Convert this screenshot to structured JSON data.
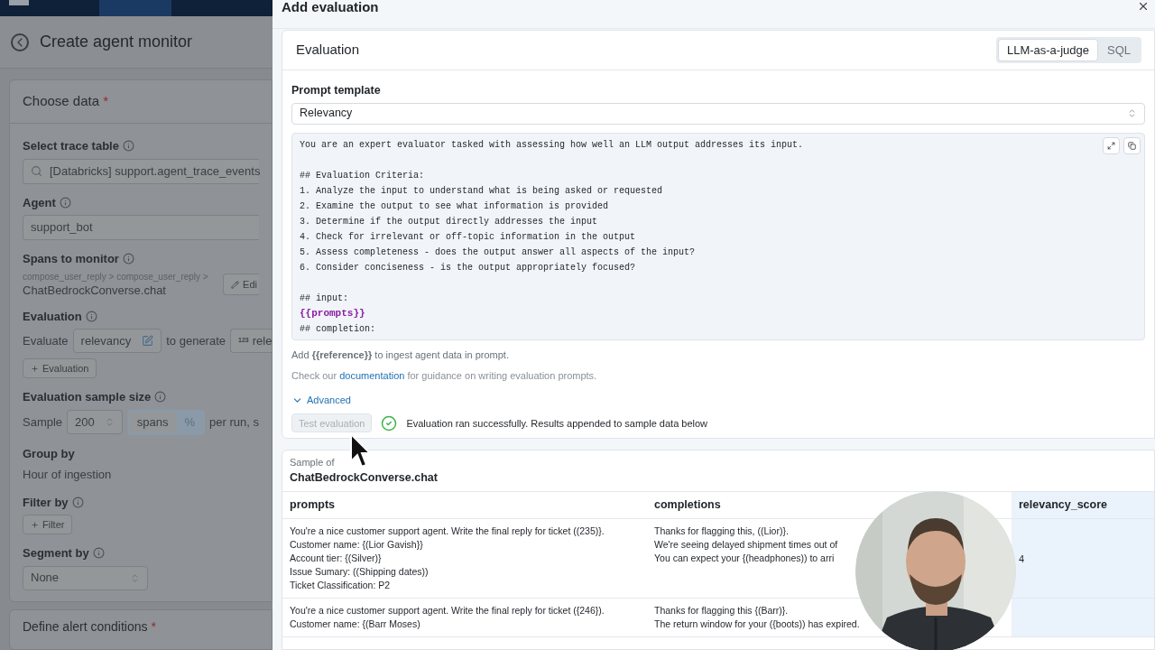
{
  "page": {
    "title": "Create agent monitor"
  },
  "choose_data": {
    "title": "Choose data",
    "required_mark": "*",
    "trace_table": {
      "label": "Select trace table",
      "value": "[Databricks] support.agent_trace_events"
    },
    "agent": {
      "label": "Agent",
      "value": "support_bot"
    },
    "spans": {
      "label": "Spans to monitor",
      "path": "compose_user_reply > compose_user_reply >",
      "span": "ChatBedrockConverse.chat",
      "edit_button": "Edi"
    },
    "evaluation": {
      "label": "Evaluation",
      "prefix": "Evaluate",
      "evaluator": "relevancy",
      "middle": "to generate",
      "metric_type": "123",
      "metric": "rele",
      "add_button": "Evaluation"
    },
    "sample_size": {
      "label": "Evaluation sample size",
      "prefix": "Sample",
      "value": "200",
      "units": [
        {
          "label": "spans",
          "selected": true
        },
        {
          "label": "%",
          "selected": false
        }
      ],
      "suffix": "per run, s"
    },
    "group_by": {
      "label": "Group by",
      "value": "Hour of ingestion"
    },
    "filter_by": {
      "label": "Filter by",
      "add_button": "Filter"
    },
    "segment_by": {
      "label": "Segment by",
      "value": "None"
    }
  },
  "alert_conditions": {
    "title": "Define alert conditions",
    "required_mark": "*"
  },
  "drawer": {
    "title": "Add evaluation",
    "evaluation_card": {
      "title": "Evaluation",
      "modes": [
        {
          "label": "LLM-as-a-judge",
          "selected": true
        },
        {
          "label": "SQL",
          "selected": false
        }
      ],
      "prompt_template": {
        "label": "Prompt template",
        "value": "Relevancy"
      },
      "prompt_lines": [
        {
          "kind": "text",
          "text": "You are an expert evaluator tasked with assessing how well an LLM output addresses its input."
        },
        {
          "kind": "blank"
        },
        {
          "kind": "text",
          "text": "## Evaluation Criteria:"
        },
        {
          "kind": "text",
          "text": "1. Analyze the input to understand what is being asked or requested"
        },
        {
          "kind": "text",
          "text": "2. Examine the output to see what information is provided"
        },
        {
          "kind": "text",
          "text": "3. Determine if the output directly addresses the input"
        },
        {
          "kind": "text",
          "text": "4. Check for irrelevant or off-topic information in the output"
        },
        {
          "kind": "text",
          "text": "5. Assess completeness - does the output answer all aspects of the input?"
        },
        {
          "kind": "text",
          "text": "6. Consider conciseness - is the output appropriately focused?"
        },
        {
          "kind": "blank"
        },
        {
          "kind": "text",
          "text": "## input:"
        },
        {
          "kind": "variable",
          "text": "{{prompts}}"
        },
        {
          "kind": "text",
          "text": "## completion:"
        }
      ],
      "hint": "Add **{{reference}}** to ingest agent data in prompt.",
      "docs": {
        "before": "Check our",
        "link": "documentation",
        "after": "for guidance on writing evaluation prompts."
      },
      "advanced": {
        "label": "Advanced",
        "expanded": false
      },
      "test_button": {
        "label": "Test evaluation",
        "disabled": true
      },
      "status": {
        "kind": "success",
        "text": "Evaluation ran successfully. Results appended to sample data below"
      }
    },
    "sample_card": {
      "caption": "Sample of",
      "span": "ChatBedrockConverse.chat",
      "columns": [
        {
          "label": "prompts",
          "highlighted": false
        },
        {
          "label": "completions",
          "highlighted": false
        },
        {
          "label": "relevancy_score",
          "highlighted": true
        }
      ],
      "rows": [
        {
          "prompts": [
            "You're a nice customer support agent. Write the final reply for ticket ((235)}.",
            "Customer name: {(Lior Gavish}}",
            "Account tier: {(Silver)}",
            "Issue Sumary: ((Shipping dates))",
            "Ticket Classification: P2"
          ],
          "completions": [
            "Thanks for flagging this, ((Lior)}.",
            "We're seeing delayed shipment times out of",
            "You can expect your {(headphones)) to arri"
          ],
          "score": "4"
        },
        {
          "prompts": [
            "You're a nice customer support agent. Write the final reply for ticket ({246}).",
            "Customer name: {(Barr Moses)"
          ],
          "completions": [
            "Thanks for flagging this {(Barr)}.",
            "The return window for your ({boots)) has expired."
          ]
        }
      ]
    }
  }
}
